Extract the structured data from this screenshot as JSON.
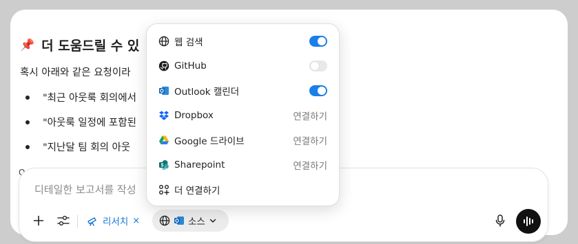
{
  "chat": {
    "heading": "더 도움드릴 수 있",
    "heading_icon": "pin-icon",
    "intro": "혹시 아래와 같은 요청이라",
    "bullets": [
      "\"최근 아웃룩 회의에서",
      "\"아웃룩 일정에 포함된",
      "\"지난달 팀 회의 아웃"
    ],
    "trailing": "O"
  },
  "composer": {
    "placeholder": "디테일한 보고서를 작성",
    "research_label": "리서치",
    "research_close": "×",
    "sources_label": "소스",
    "research_color": "#1677d9"
  },
  "sources_menu": {
    "items": [
      {
        "icon": "globe-icon",
        "label": "웹 검색",
        "toggle": "on"
      },
      {
        "icon": "github-icon",
        "label": "GitHub",
        "toggle": "off"
      },
      {
        "icon": "outlook-icon",
        "label": "Outlook 캘린더",
        "toggle": "on"
      },
      {
        "icon": "dropbox-icon",
        "label": "Dropbox",
        "action": "연결하기"
      },
      {
        "icon": "google-drive-icon",
        "label": "Google 드라이브",
        "action": "연결하기"
      },
      {
        "icon": "sharepoint-icon",
        "label": "Sharepoint",
        "action": "연결하기"
      },
      {
        "icon": "apps-icon",
        "label": "더 연결하기"
      }
    ],
    "toggle_on_color": "#1a7fe8"
  }
}
